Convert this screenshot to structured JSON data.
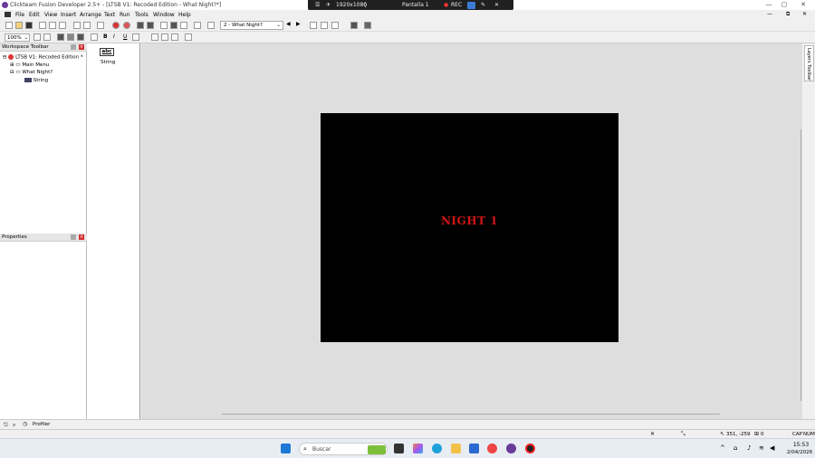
{
  "window": {
    "title": "Clickteam Fusion Developer 2.5+ - [LTSB V1: Recoded Edition - What Night?*]",
    "min": "—",
    "max": "▢",
    "close": "✕",
    "inner_min": "—",
    "inner_restore": "⧉",
    "inner_close": "✕"
  },
  "recorder": {
    "resolution": "1920x1080",
    "screen": "Pantalla 1",
    "rec": "REC"
  },
  "menu": [
    "File",
    "Edit",
    "View",
    "Insert",
    "Arrange",
    "Text",
    "Run",
    "Tools",
    "Window",
    "Help"
  ],
  "toolbar": {
    "frame": "2 - What Night?",
    "zoom": "100%",
    "bold": "B",
    "italic": "I",
    "underline": "U"
  },
  "workspace": {
    "title": "Workspace Toolbar",
    "tree": [
      "LTSB V1: Recoded Edition *",
      "Main Menu",
      "What Night?",
      "String"
    ]
  },
  "properties": {
    "title": "Properties"
  },
  "objects": {
    "icon_label": "abc",
    "label": "String"
  },
  "stage": {
    "text": "NIGHT 1",
    "text_color": "#d01515",
    "bg": "#000000"
  },
  "layers": {
    "title": "Layers Toolbar"
  },
  "bottom": {
    "profiler": "Profiler"
  },
  "status": {
    "coords": "351, -259",
    "count": "0",
    "caps": "CAP",
    "num": "NUM"
  },
  "taskbar": {
    "search": "Buscar",
    "time": "15:53",
    "date": "2/04/2026"
  }
}
